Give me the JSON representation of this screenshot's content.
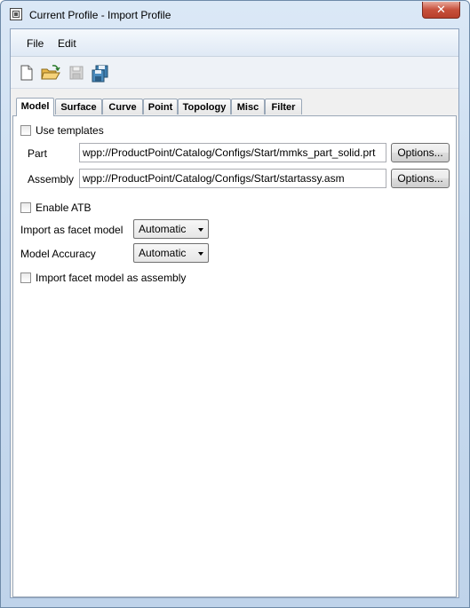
{
  "window": {
    "title": "Current Profile - Import Profile",
    "close_glyph": "✕"
  },
  "menu": {
    "items": [
      {
        "label": "File"
      },
      {
        "label": "Edit"
      }
    ]
  },
  "toolbar": {
    "icons": [
      "new-file-icon",
      "open-folder-icon",
      "save-icon",
      "save-as-icon"
    ]
  },
  "tabs": [
    {
      "label": "Model",
      "active": true
    },
    {
      "label": "Surface"
    },
    {
      "label": "Curve"
    },
    {
      "label": "Point"
    },
    {
      "label": "Topology"
    },
    {
      "label": "Misc"
    },
    {
      "label": "Filter"
    }
  ],
  "model": {
    "use_templates": {
      "label": "Use templates",
      "checked": false
    },
    "part": {
      "label": "Part",
      "value": "wpp://ProductPoint/Catalog/Configs/Start/mmks_part_solid.prt",
      "button": "Options..."
    },
    "assembly": {
      "label": "Assembly",
      "value": "wpp://ProductPoint/Catalog/Configs/Start/startassy.asm",
      "button": "Options..."
    },
    "enable_atb": {
      "label": "Enable ATB",
      "checked": false
    },
    "import_facet": {
      "label": "Import as facet model",
      "value": "Automatic"
    },
    "model_accuracy": {
      "label": "Model Accuracy",
      "value": "Automatic"
    },
    "import_facet_assembly": {
      "label": "Import facet model as assembly",
      "checked": false
    }
  }
}
